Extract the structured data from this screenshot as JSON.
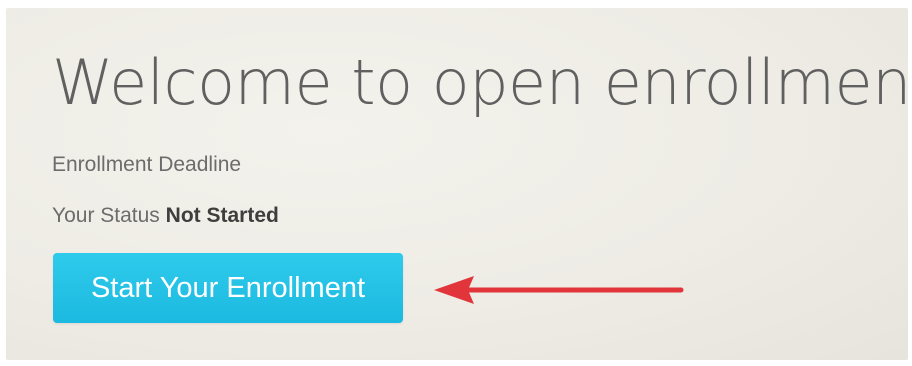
{
  "page": {
    "title": "Welcome to open enrollment!",
    "deadline_label": "Enrollment Deadline",
    "status_label": "Your Status",
    "status_value": "Not Started",
    "start_button_label": "Start Your Enrollment"
  },
  "colors": {
    "button": "#22bfe4",
    "arrow": "#e2343b",
    "title_text": "#606060"
  }
}
